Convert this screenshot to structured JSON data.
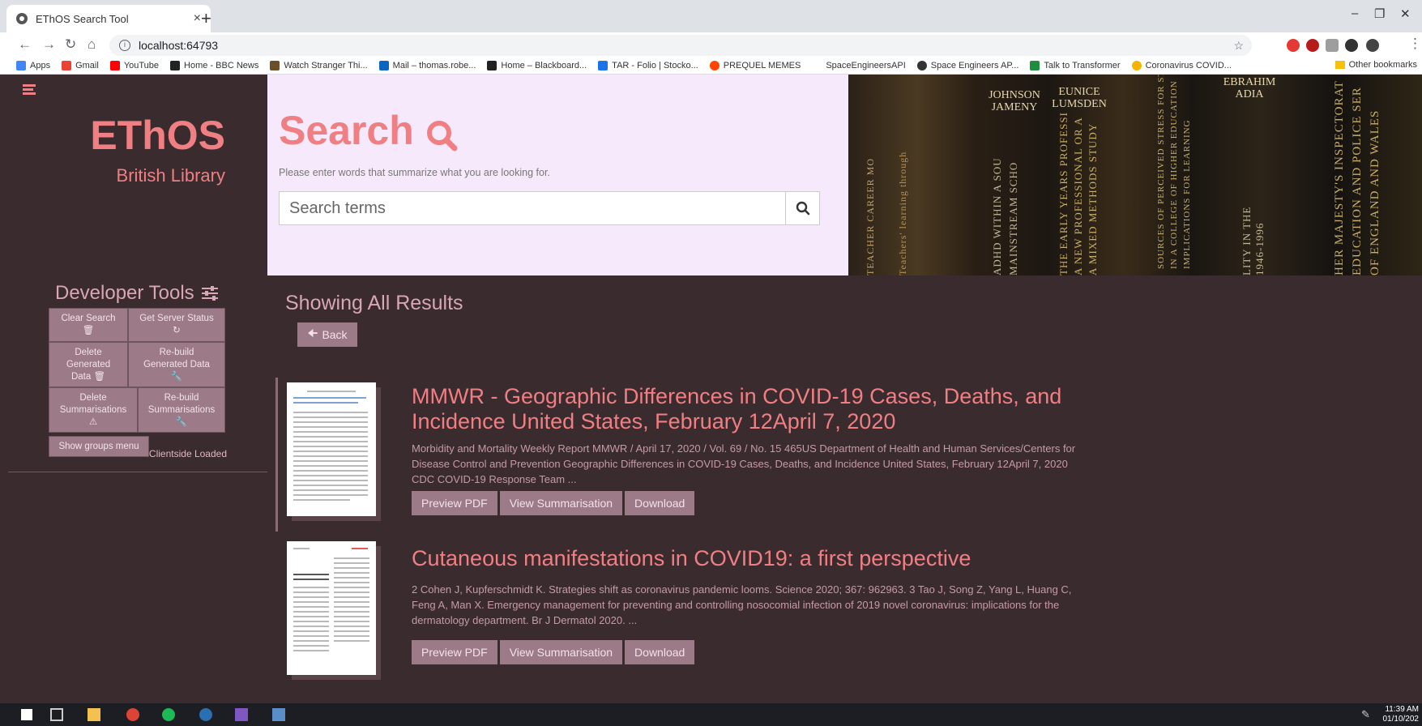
{
  "browser": {
    "tab_title": "EThOS Search Tool",
    "tab_close": "×",
    "new_tab": "+",
    "url": "localhost:64793",
    "bookmarks": [
      {
        "label": "Apps",
        "color": "#4285f4"
      },
      {
        "label": "Gmail",
        "color": "#ea4335"
      },
      {
        "label": "YouTube",
        "color": "#ff0000"
      },
      {
        "label": "Home - BBC News",
        "color": "#222222"
      },
      {
        "label": "Watch Stranger Thi...",
        "color": "#6b4f2a"
      },
      {
        "label": "Mail – thomas.robe...",
        "color": "#0a66c2"
      },
      {
        "label": "Home – Blackboard...",
        "color": "#222222"
      },
      {
        "label": "TAR - Folio | Stocko...",
        "color": "#1a73e8"
      },
      {
        "label": "PREQUEL MEMES",
        "color": "#ff4500"
      },
      {
        "label": "SpaceEngineersAPI",
        "color": "#ffffff"
      },
      {
        "label": "Space Engineers AP...",
        "color": "#333333"
      },
      {
        "label": "Talk to Transformer",
        "color": "#1e8e3e"
      },
      {
        "label": "Coronavirus COVID...",
        "color": "#f4b400"
      }
    ],
    "other_bookmarks": "Other bookmarks"
  },
  "brand": {
    "title": "EThOS",
    "subtitle": "British Library"
  },
  "search": {
    "heading": "Search",
    "help": "Please enter words that summarize what you are looking for.",
    "placeholder": "Search terms"
  },
  "banner": {
    "spines": [
      "TEACHER CAREER MO",
      "Teachers' learning through",
      "ADHD WITHIN A SOU",
      "MAINSTREAM SCHO",
      "THE EARLY YEARS PROFESSI",
      "A NEW PROFESSIONAL OR A",
      "A MIXED METHODS STUDY",
      "SOURCES OF PERCEIVED STRESS FOR ST",
      "IN A COLLEGE OF HIGHER EDUCATION",
      "IMPLICATIONS FOR LEARNING",
      "LITY IN THE",
      "1946-1996",
      "HER MAJESTY'S INSPECTORAT",
      "EDUCATION AND POLICE SER",
      "OF ENGLAND AND WALES"
    ],
    "authors": [
      "JOHNSON JAMENY",
      "EUNICE LUMSDEN",
      "EBRAHIM ADIA"
    ]
  },
  "dev_tools": {
    "title": "Developer Tools",
    "buttons": {
      "clear_search": "Clear Search",
      "get_server_status": "Get Server Status",
      "delete_generated_1": "Delete",
      "delete_generated_2": "Generated",
      "delete_generated_3": "Data",
      "rebuild_generated_1": "Re-build",
      "rebuild_generated_2": "Generated Data",
      "delete_summ_1": "Delete",
      "delete_summ_2": "Summarisations",
      "rebuild_summ_1": "Re-build",
      "rebuild_summ_2": "Summarisations",
      "show_groups": "Show groups menu"
    },
    "status": "Clientside Loaded"
  },
  "results": {
    "title": "Showing All Results",
    "back": "Back",
    "items": [
      {
        "title": "MMWR - Geographic Differences in COVID-19 Cases, Deaths, and Incidence United States, February 12April 7, 2020",
        "description": "Morbidity and Mortality Weekly Report MMWR / April 17, 2020 / Vol. 69 / No. 15 465US Department of Health and Human Services/Centers for Disease Control and Prevention Geographic Differences in COVID-19 Cases, Deaths, and Incidence United States, February 12April 7, 2020 CDC COVID-19 Response Team ...",
        "preview": "Preview PDF",
        "summary": "View Summarisation",
        "download": "Download"
      },
      {
        "title": "Cutaneous manifestations in COVID19: a first perspective",
        "description": "2 Cohen J, Kupferschmidt K. Strategies shift as coronavirus pandemic looms. Science 2020; 367: 962963. 3 Tao J, Song Z, Yang L, Huang C, Feng A, Man X. Emergency management for preventing and controlling nosocomial infection of 2019 novel coronavirus: implications for the dermatology department. Br J Dermatol 2020. ...",
        "preview": "Preview PDF",
        "summary": "View Summarisation",
        "download": "Download"
      }
    ]
  },
  "taskbar": {
    "time": "11:39 AM",
    "date": "01/10/202"
  },
  "colors": {
    "accent": "#f07f83",
    "panel": "#3a2b2f",
    "button": "#9c7a87",
    "search_bg": "#f6e9fb"
  }
}
